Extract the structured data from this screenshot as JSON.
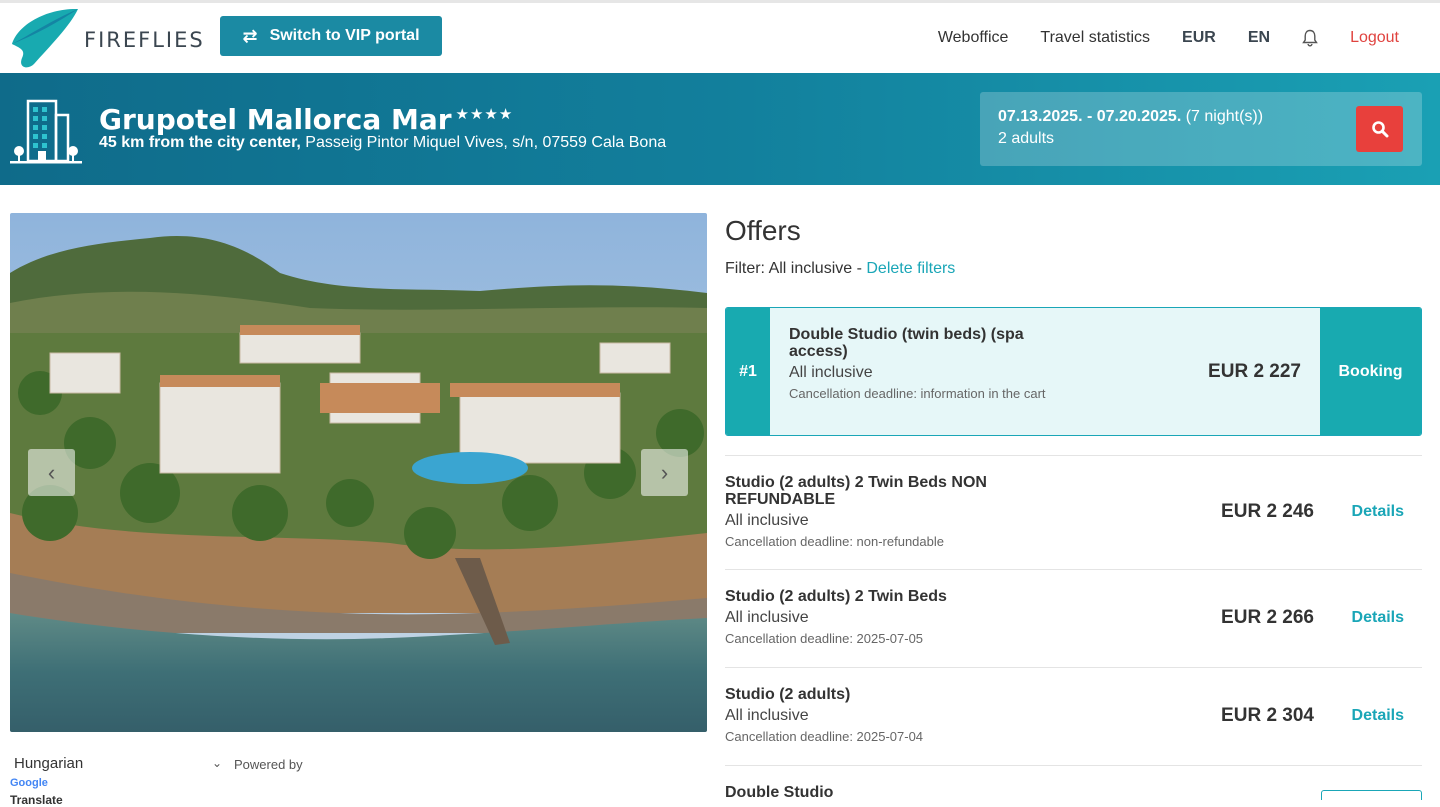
{
  "brand": {
    "name": "FIREFLIES",
    "colors": {
      "teal": "#1b8aa3",
      "accent": "#18aab0",
      "red": "#e8403c"
    }
  },
  "header": {
    "vip_button": "Switch to VIP portal",
    "nav": {
      "weboffice": "Weboffice",
      "travel_statistics": "Travel statistics",
      "currency": "EUR",
      "language": "EN",
      "logout": "Logout"
    }
  },
  "hotel": {
    "name": "Grupotel Mallorca Mar",
    "stars": "★★★★",
    "distance": "45 km from the city center,",
    "address": " Passeig Pintor Miquel Vives, s/n, 07559 Cala Bona"
  },
  "search": {
    "dates": "07.13.2025. - 07.20.2025.",
    "nights": " (7 night(s))",
    "guests": "2 adults"
  },
  "gallery": {
    "prev": "‹",
    "next": "›"
  },
  "translate": {
    "language": "Hungarian",
    "caret": "⌄",
    "powered_by": "Powered by",
    "google": "Google",
    "translate_label": "Translate"
  },
  "offers": {
    "title": "Offers",
    "filter_label": "Filter: All inclusive",
    "filter_sep": " - ",
    "delete_filters": "Delete filters",
    "top_offer": {
      "rank": "#1",
      "title": "Double Studio (twin beds) (spa access)",
      "board": "All inclusive",
      "cancellation": "Cancellation deadline: information in the cart",
      "price": "EUR 2 227",
      "button": "Booking"
    },
    "rows": [
      {
        "title": "Studio (2 adults) 2 Twin Beds NON REFUNDABLE",
        "board": "All inclusive",
        "cancellation": "Cancellation deadline: non-refundable",
        "price": "EUR 2 246",
        "button": "Details"
      },
      {
        "title": "Studio (2 adults) 2 Twin Beds",
        "board": "All inclusive",
        "cancellation": "Cancellation deadline: 2025-07-05",
        "price": "EUR 2 266",
        "button": "Details"
      },
      {
        "title": "Studio (2 adults)",
        "board": "All inclusive",
        "cancellation": "Cancellation deadline: 2025-07-04",
        "price": "EUR 2 304",
        "button": "Details"
      },
      {
        "title": "Double Studio"
      }
    ]
  }
}
